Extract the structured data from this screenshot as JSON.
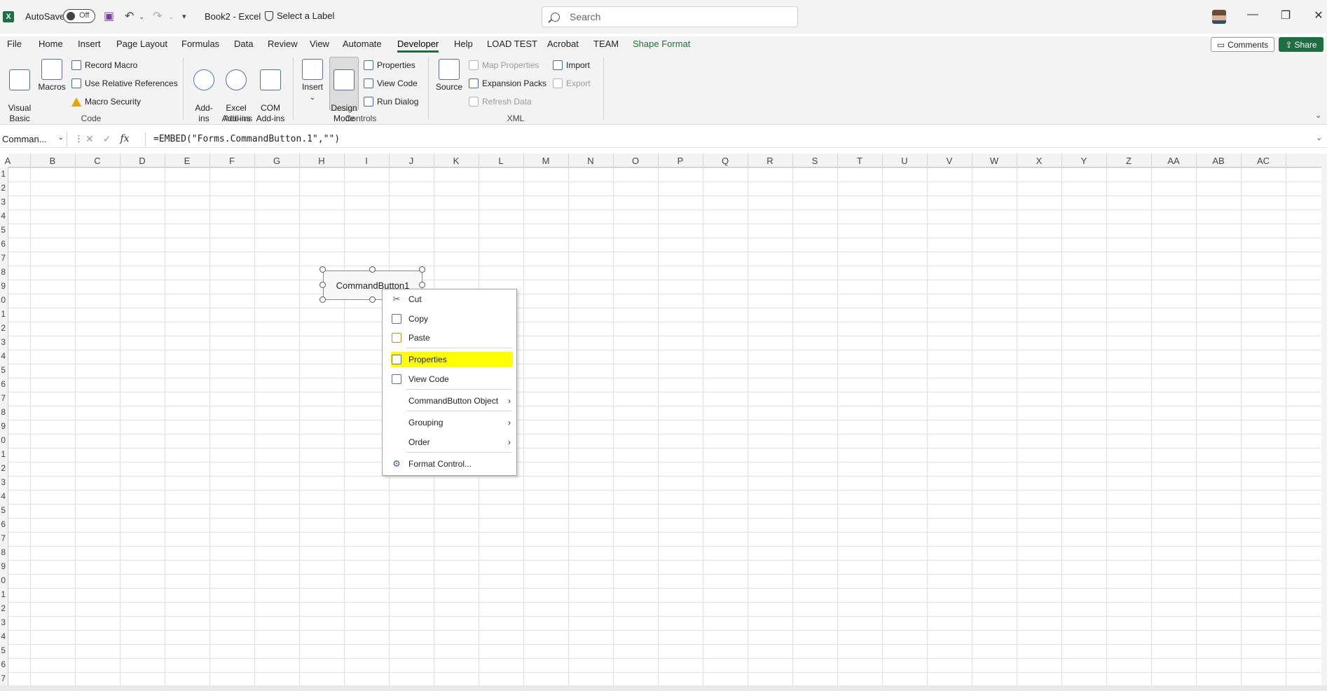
{
  "titlebar": {
    "app_logo": "X",
    "autosave_label": "AutoSave",
    "autosave_state": "Off",
    "doc_title": "Book2  -  Excel",
    "sensitivity_label": "Select a Label",
    "search_placeholder": "Search"
  },
  "tabs": [
    {
      "label": "File"
    },
    {
      "label": "Home"
    },
    {
      "label": "Insert"
    },
    {
      "label": "Page Layout"
    },
    {
      "label": "Formulas"
    },
    {
      "label": "Data"
    },
    {
      "label": "Review"
    },
    {
      "label": "View"
    },
    {
      "label": "Automate"
    },
    {
      "label": "Developer"
    },
    {
      "label": "Help"
    },
    {
      "label": "LOAD TEST"
    },
    {
      "label": "Acrobat"
    },
    {
      "label": "TEAM"
    },
    {
      "label": "Shape Format"
    }
  ],
  "comments_label": "Comments",
  "share_label": "Share",
  "ribbon": {
    "visual_basic": "Visual\nBasic",
    "macros": "Macros",
    "record_macro": "Record Macro",
    "use_relative": "Use Relative References",
    "macro_security": "Macro Security",
    "group_code": "Code",
    "add_ins": "Add-\nins",
    "excel_add_ins": "Excel\nAdd-ins",
    "com_add_ins": "COM\nAdd-ins",
    "group_addins": "Add-ins",
    "insert": "Insert",
    "design_mode": "Design\nMode",
    "properties": "Properties",
    "view_code": "View Code",
    "run_dialog": "Run Dialog",
    "group_controls": "Controls",
    "source": "Source",
    "map_properties": "Map Properties",
    "expansion_packs": "Expansion Packs",
    "refresh_data": "Refresh Data",
    "import": "Import",
    "export": "Export",
    "group_xml": "XML"
  },
  "formula_bar": {
    "name_box": "Comman...",
    "formula": "=EMBED(\"Forms.CommandButton.1\",\"\")"
  },
  "columns": [
    "A",
    "B",
    "C",
    "D",
    "E",
    "F",
    "G",
    "H",
    "I",
    "J",
    "K",
    "L",
    "M",
    "N",
    "O",
    "P",
    "Q",
    "R",
    "S",
    "T",
    "U",
    "V",
    "W",
    "X",
    "Y",
    "Z",
    "AA",
    "AB",
    "AC"
  ],
  "rows": [
    "1",
    "2",
    "3",
    "4",
    "5",
    "6",
    "7",
    "8",
    "9",
    "0",
    "1",
    "2",
    "3",
    "4",
    "5",
    "6",
    "7",
    "8",
    "9",
    "0",
    "1",
    "2",
    "3",
    "4",
    "5",
    "6",
    "7",
    "8",
    "9",
    "0",
    "1",
    "2",
    "3",
    "4",
    "5",
    "6",
    "7"
  ],
  "command_button_caption": "CommandButton1",
  "context_menu": {
    "cut": "Cut",
    "copy": "Copy",
    "paste": "Paste",
    "properties": "Properties",
    "view_code": "View Code",
    "commandbutton_object": "CommandButton Object",
    "grouping": "Grouping",
    "order": "Order",
    "format_control": "Format Control..."
  },
  "colors": {
    "accent": "#1d6f42",
    "highlight": "#ffff00"
  }
}
